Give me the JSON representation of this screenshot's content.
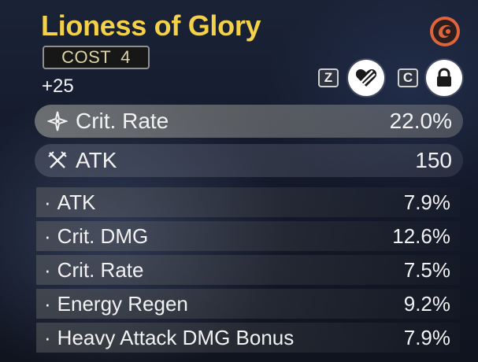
{
  "echo": {
    "name": "Lioness of Glory",
    "cost_label": "COST",
    "cost_value": "4",
    "level": "+25"
  },
  "controls": {
    "discard_key": "Z",
    "lock_key": "C",
    "discard_icon": "heart-slash-icon",
    "lock_icon": "lock-icon",
    "sonata_icon": "sonata-set-icon"
  },
  "main_stats": [
    {
      "icon": "crit-rate-icon",
      "label": "Crit. Rate",
      "value": "22.0%"
    },
    {
      "icon": "atk-swords-icon",
      "label": "ATK",
      "value": "150"
    }
  ],
  "sub_stats": [
    {
      "label": "ATK",
      "value": "7.9%"
    },
    {
      "label": "Crit. DMG",
      "value": "12.6%"
    },
    {
      "label": "Crit. Rate",
      "value": "7.5%"
    },
    {
      "label": "Energy Regen",
      "value": "9.2%"
    },
    {
      "label": "Heavy Attack DMG Bonus",
      "value": "7.9%"
    }
  ],
  "colors": {
    "title": "#f3d24a",
    "sonata_ring": "#e0643a"
  }
}
